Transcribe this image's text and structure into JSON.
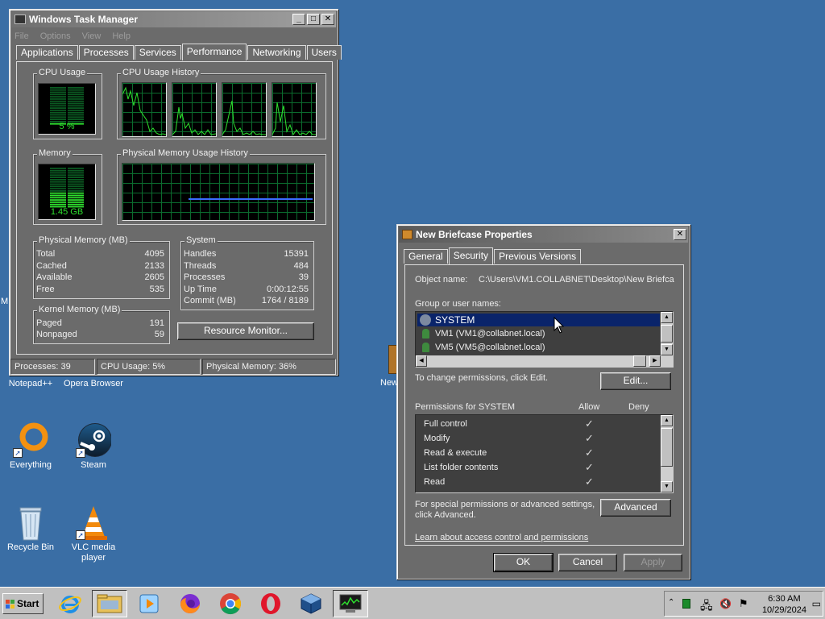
{
  "desktop": {
    "partial_left_label": "M",
    "top_labels": [
      {
        "id": "notepad",
        "label": "Notepad++"
      },
      {
        "id": "opera",
        "label": "Opera Browser"
      }
    ],
    "icons": [
      {
        "id": "everything",
        "label": "Everything"
      },
      {
        "id": "steam",
        "label": "Steam"
      },
      {
        "id": "recycle",
        "label": "Recycle Bin"
      },
      {
        "id": "vlc",
        "label": "VLC media player"
      }
    ],
    "partial_icon_label": "New"
  },
  "taskmgr": {
    "title": "Windows Task Manager",
    "menu": [
      "File",
      "Options",
      "View",
      "Help"
    ],
    "tabs": [
      "Applications",
      "Processes",
      "Services",
      "Performance",
      "Networking",
      "Users"
    ],
    "selected_tab": "Performance",
    "cpu_usage_label": "CPU Usage",
    "cpu_usage_value": "5 %",
    "cpu_history_label": "CPU Usage History",
    "memory_label": "Memory",
    "memory_value": "1.45 GB",
    "phys_history_label": "Physical Memory Usage History",
    "physical_memory": {
      "title": "Physical Memory (MB)",
      "rows": [
        {
          "k": "Total",
          "v": "4095"
        },
        {
          "k": "Cached",
          "v": "2133"
        },
        {
          "k": "Available",
          "v": "2605"
        },
        {
          "k": "Free",
          "v": "535"
        }
      ]
    },
    "kernel_memory": {
      "title": "Kernel Memory (MB)",
      "rows": [
        {
          "k": "Paged",
          "v": "191"
        },
        {
          "k": "Nonpaged",
          "v": "59"
        }
      ]
    },
    "system": {
      "title": "System",
      "rows": [
        {
          "k": "Handles",
          "v": "15391"
        },
        {
          "k": "Threads",
          "v": "484"
        },
        {
          "k": "Processes",
          "v": "39"
        },
        {
          "k": "Up Time",
          "v": "0:00:12:55"
        },
        {
          "k": "Commit (MB)",
          "v": "1764 / 8189"
        }
      ]
    },
    "resource_monitor_button": "Resource Monitor...",
    "status": {
      "processes": "Processes: 39",
      "cpu": "CPU Usage: 5%",
      "memory": "Physical Memory: 36%"
    }
  },
  "props": {
    "title": "New Briefcase Properties",
    "tabs": [
      "General",
      "Security",
      "Previous Versions"
    ],
    "selected_tab": "Security",
    "object_name_label": "Object name:",
    "object_name_value": "C:\\Users\\VM1.COLLABNET\\Desktop\\New Briefca",
    "group_label": "Group or user names:",
    "users": [
      {
        "name": "SYSTEM",
        "selected": true
      },
      {
        "name": "VM1 (VM1@collabnet.local)",
        "selected": false
      },
      {
        "name": "VM5 (VM5@collabnet.local)",
        "selected": false
      }
    ],
    "change_text": "To change permissions, click Edit.",
    "edit_button": "Edit...",
    "permissions_label": "Permissions for SYSTEM",
    "allow_label": "Allow",
    "deny_label": "Deny",
    "permissions": [
      {
        "name": "Full control",
        "allow": true
      },
      {
        "name": "Modify",
        "allow": true
      },
      {
        "name": "Read & execute",
        "allow": true
      },
      {
        "name": "List folder contents",
        "allow": true
      },
      {
        "name": "Read",
        "allow": true
      }
    ],
    "special_text_1": "For special permissions or advanced settings,",
    "special_text_2": "click Advanced.",
    "advanced_button": "Advanced",
    "learn_link": "Learn about access control and permissions",
    "ok_button": "OK",
    "cancel_button": "Cancel",
    "apply_button": "Apply"
  },
  "taskbar": {
    "start_label": "Start",
    "apps": [
      "internet-explorer",
      "file-explorer",
      "media-player",
      "firefox",
      "chrome",
      "opera",
      "virtualbox",
      "task-manager"
    ],
    "clock_time": "6:30 AM",
    "clock_date": "10/29/2024"
  },
  "colors": {
    "desktop": "#3a6ea5",
    "window_face": "#6b6b6b",
    "graph_green": "#2ee12e",
    "selection": "#0a246a"
  }
}
